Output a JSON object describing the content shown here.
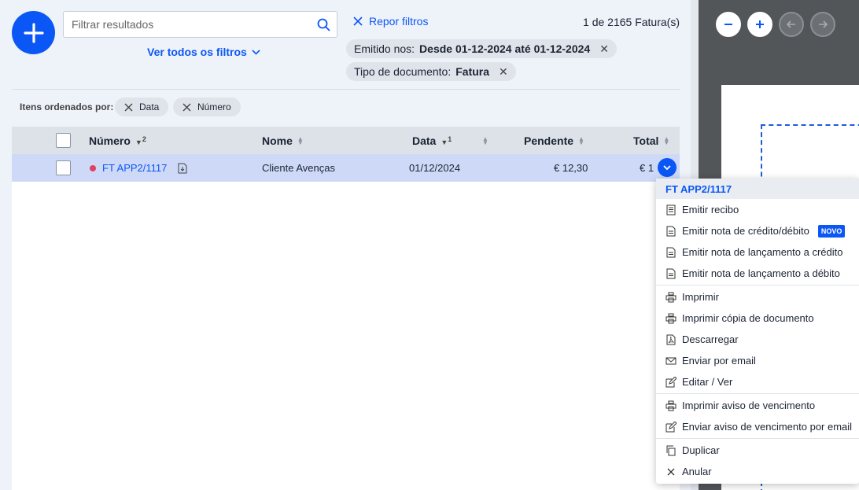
{
  "search": {
    "placeholder": "Filtrar resultados"
  },
  "filters": {
    "all_filters_label": "Ver todos os filtros",
    "reset_label": "Repor filtros",
    "result_count": "1 de 2165 Fatura(s)",
    "chips": [
      {
        "key": "Emitido nos:",
        "value": "Desde 01-12-2024 até 01-12-2024"
      },
      {
        "key": "Tipo de documento:",
        "value": "Fatura"
      }
    ]
  },
  "sorting": {
    "label": "Itens ordenados por:",
    "chips": [
      "Data",
      "Número"
    ]
  },
  "table": {
    "headers": {
      "numero": "Número",
      "numero_order": "2",
      "nome": "Nome",
      "data": "Data",
      "data_order": "1",
      "pendente": "Pendente",
      "total": "Total"
    },
    "rows": [
      {
        "numero": "FT APP2/1117",
        "nome": "Cliente Avenças",
        "data": "01/12/2024",
        "pendente": "€ 12,30",
        "total": "€ 1",
        "status_color": "#e14060"
      }
    ]
  },
  "menu": {
    "title": "FT APP2/1117",
    "new_badge": "NOVO",
    "items": [
      {
        "label": "Emitir recibo",
        "icon": "receipt-icon"
      },
      {
        "label": "Emitir nota de crédito/débito",
        "icon": "document-icon"
      },
      {
        "label": "Emitir nota de lançamento a crédito",
        "icon": "document-icon"
      },
      {
        "label": "Emitir nota de lançamento a débito",
        "icon": "document-icon"
      },
      {
        "label": "Imprimir",
        "icon": "printer-icon"
      },
      {
        "label": "Imprimir cópia de documento",
        "icon": "printer-icon"
      },
      {
        "label": "Descarregar",
        "icon": "pdf-icon"
      },
      {
        "label": "Enviar por email",
        "icon": "envelope-icon"
      },
      {
        "label": "Editar / Ver",
        "icon": "edit-icon"
      },
      {
        "label": "Imprimir aviso de vencimento",
        "icon": "printer-icon"
      },
      {
        "label": "Enviar aviso de vencimento por email",
        "icon": "edit-icon"
      },
      {
        "label": "Duplicar",
        "icon": "copy-icon"
      },
      {
        "label": "Anular",
        "icon": "close-icon"
      }
    ]
  },
  "colors": {
    "accent": "#0b57f5",
    "status_dot": "#e14060",
    "row_selected": "#cdd9f7"
  }
}
